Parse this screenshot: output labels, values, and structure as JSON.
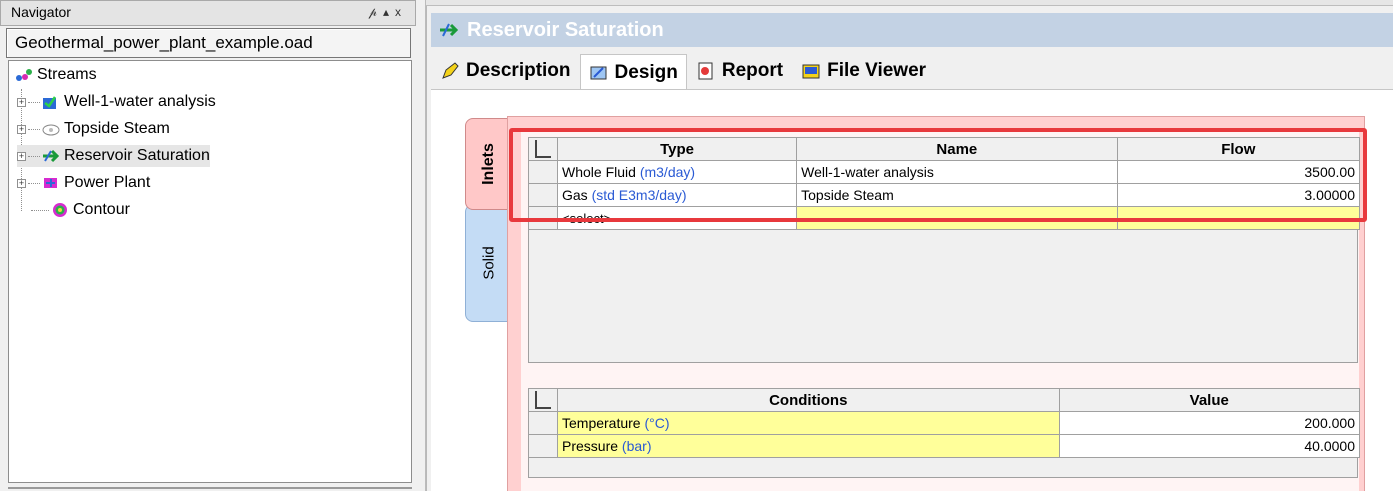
{
  "navigator": {
    "title": "Navigator",
    "controls": "p ▴ x",
    "file": "Geothermal_power_plant_example.oad",
    "tree": {
      "root": "Streams",
      "items": [
        {
          "label": "Well-1-water analysis"
        },
        {
          "label": "Topside Steam"
        },
        {
          "label": "Reservoir Saturation"
        },
        {
          "label": "Power Plant"
        },
        {
          "label": "Contour"
        }
      ]
    }
  },
  "panel": {
    "title": "Reservoir Saturation",
    "tabs": [
      {
        "label": "Description"
      },
      {
        "label": "Design"
      },
      {
        "label": "Report"
      },
      {
        "label": "File Viewer"
      }
    ],
    "side_tabs": [
      "Inlets",
      "Solid"
    ]
  },
  "inlets": {
    "headers": [
      "Type",
      "Name",
      "Flow"
    ],
    "rows": [
      {
        "type": "Whole Fluid",
        "unit": "(m3/day)",
        "name": "Well-1-water analysis",
        "flow": "3500.00"
      },
      {
        "type": "Gas",
        "unit": "(std E3m3/day)",
        "name": "Topside Steam",
        "flow": "3.00000"
      }
    ],
    "select_placeholder": "<select>"
  },
  "conditions": {
    "headers": [
      "Conditions",
      "Value"
    ],
    "rows": [
      {
        "label": "Temperature",
        "unit": "(°C)",
        "value": "200.000"
      },
      {
        "label": "Pressure",
        "unit": "(bar)",
        "value": "40.0000"
      }
    ]
  },
  "colors": {
    "title_bar": "#c3d2e4",
    "highlight": "#e8393d",
    "input_yellow": "#ffff9a",
    "unit_blue": "#2a5ad4"
  }
}
